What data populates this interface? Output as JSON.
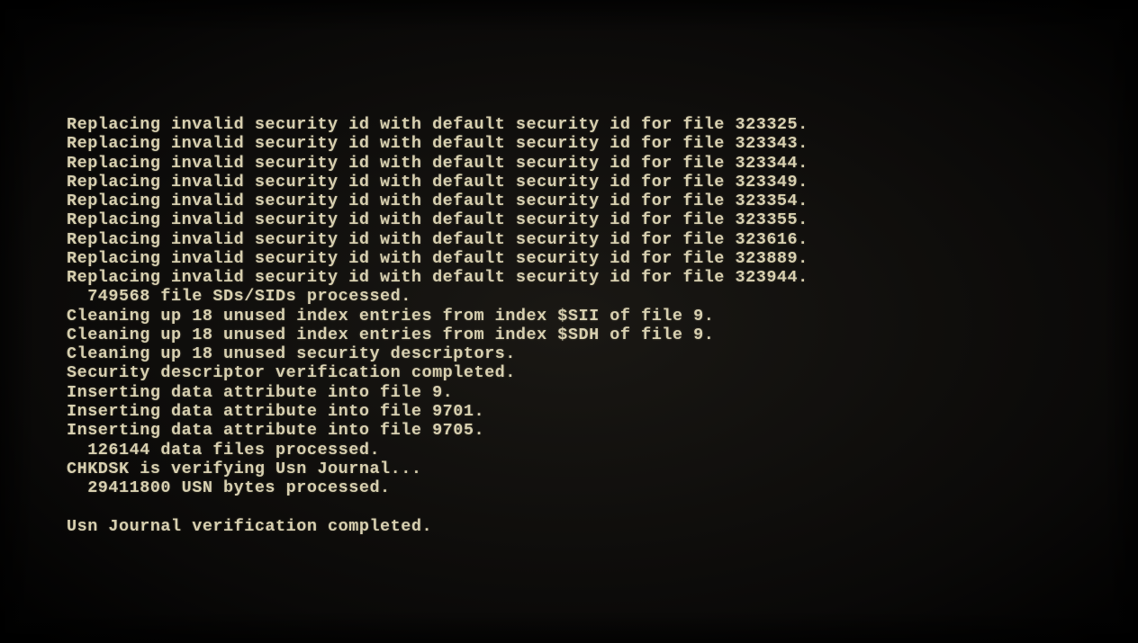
{
  "console": {
    "lines": [
      "Replacing invalid security id with default security id for file 323325.",
      "Replacing invalid security id with default security id for file 323343.",
      "Replacing invalid security id with default security id for file 323344.",
      "Replacing invalid security id with default security id for file 323349.",
      "Replacing invalid security id with default security id for file 323354.",
      "Replacing invalid security id with default security id for file 323355.",
      "Replacing invalid security id with default security id for file 323616.",
      "Replacing invalid security id with default security id for file 323889.",
      "Replacing invalid security id with default security id for file 323944.",
      "  749568 file SDs/SIDs processed.",
      "Cleaning up 18 unused index entries from index $SII of file 9.",
      "Cleaning up 18 unused index entries from index $SDH of file 9.",
      "Cleaning up 18 unused security descriptors.",
      "Security descriptor verification completed.",
      "Inserting data attribute into file 9.",
      "Inserting data attribute into file 9701.",
      "Inserting data attribute into file 9705.",
      "  126144 data files processed.",
      "CHKDSK is verifying Usn Journal...",
      "  29411800 USN bytes processed.",
      "",
      "Usn Journal verification completed."
    ]
  }
}
